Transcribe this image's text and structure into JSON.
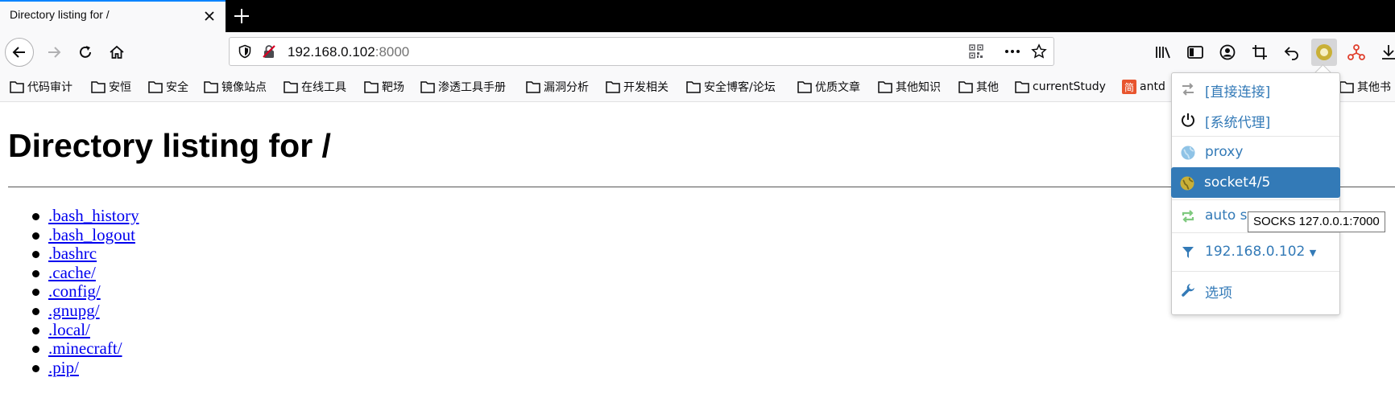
{
  "browser": {
    "tab_title": "Directory listing for /",
    "url_host": "192.168.0.102",
    "url_port": ":8000"
  },
  "toolbar_icons": [
    "library-icon",
    "sidebar-icon",
    "account-icon",
    "screenshot-crop-icon",
    "undo-icon",
    "proxy-switcher-icon",
    "network-icon",
    "download-icon"
  ],
  "bookmarks": [
    "代码审计",
    "安恒",
    "安全",
    "镜像站点",
    "在线工具",
    "靶场",
    "渗透工具手册",
    "漏洞分析",
    "开发相关",
    "安全博客/论坛",
    "优质文章",
    "其他知识",
    "其他",
    "currentStudy",
    "antd",
    "其他书"
  ],
  "page": {
    "title": "Directory listing for /",
    "files": [
      ".bash_history",
      ".bash_logout",
      ".bashrc",
      ".cache/",
      ".config/",
      ".gnupg/",
      ".local/",
      ".minecraft/",
      ".pip/"
    ]
  },
  "proxy_menu": {
    "items": [
      {
        "label": "[直接连接]",
        "icon": "direct-connect-icon"
      },
      {
        "label": "[系统代理]",
        "icon": "power-icon"
      },
      {
        "label": "proxy",
        "icon": "globe-icon"
      },
      {
        "label": "socket4/5",
        "icon": "globe-icon",
        "selected": true
      },
      {
        "label": "auto sw",
        "icon": "auto-switch-icon"
      },
      {
        "label": "192.168.0.102",
        "icon": "filter-icon"
      },
      {
        "label": "选项",
        "icon": "wrench-icon"
      }
    ],
    "tooltip": "SOCKS 127.0.0.1:7000",
    "colors": {
      "accent": "#337ab7",
      "globe_active": "#c9b037",
      "globe_idle": "#8fc3e6",
      "auto_switch": "#7fc97f"
    }
  }
}
